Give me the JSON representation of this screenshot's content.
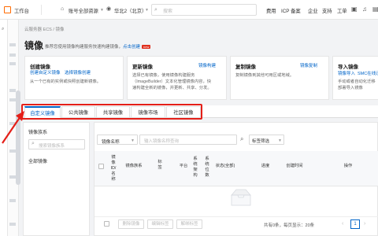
{
  "topbar": {
    "workbench": "工作台",
    "account": "账号全部资源",
    "region": "华北2（北京）",
    "search_placeholder": "搜索",
    "links": [
      "费用",
      "ICP 备案",
      "企业",
      "支持",
      "工单"
    ]
  },
  "breadcrumb": {
    "part1": "云服务器 ECS",
    "sep": "/",
    "part2": "镜像"
  },
  "page": {
    "title": "镜像",
    "subtitle": "推荐您使用镜像构建服务快速构建镜像，",
    "subtitle_link": "点击创建",
    "badge": "new"
  },
  "cards": [
    {
      "title": "创建镜像",
      "links": [
        "创建自定义镜像",
        "选择镜像创建"
      ],
      "desc": [
        "从一个已有的实例或快照创建新镜像。"
      ]
    },
    {
      "title": "更新镜像",
      "link": "镜像构建",
      "desc": [
        "选择已有镜像，使用镜像构建服务",
        "（ImageBuilder）文本化管理镜像内容，快",
        "速构建全新的镜像，并更新、共享、分发。"
      ]
    },
    {
      "title": "复制镜像",
      "link": "镜像复制",
      "desc": [
        "复制镜像到其他可用区或地域。"
      ]
    },
    {
      "title": "导入镜像",
      "link": "镜像导入",
      "link2": "SMC在线迁",
      "desc": [
        "手动或者自动化迁移",
        "部署导入镜像"
      ]
    }
  ],
  "tabs": [
    "自定义镜像",
    "公共镜像",
    "共享镜像",
    "镜像市场",
    "社区镜像"
  ],
  "left_panel": {
    "title": "镜像族系",
    "search_placeholder": "搜索镜像族系",
    "item": "全部镜像"
  },
  "filter": {
    "select_label": "镜像名称",
    "input_placeholder": "输入镜像名称查询",
    "tag_filter": "标签筛选"
  },
  "table_headers": {
    "id": [
      "镜",
      "像",
      "ID/",
      "名",
      "称"
    ],
    "family": "镜像族系",
    "tags": [
      "标",
      "签"
    ],
    "platform": "平台",
    "arch": [
      "系",
      "统",
      "架",
      "构"
    ],
    "bits": [
      "系",
      "统",
      "位",
      "数"
    ],
    "status": "状态(全部)",
    "progress": "进度",
    "created": "创建时间",
    "actions": "操作"
  },
  "footer": {
    "buttons": [
      "删除镜像",
      "编辑标签",
      "解绑标签"
    ],
    "summary": "共有0条，每页显示：20条",
    "page": "1"
  }
}
